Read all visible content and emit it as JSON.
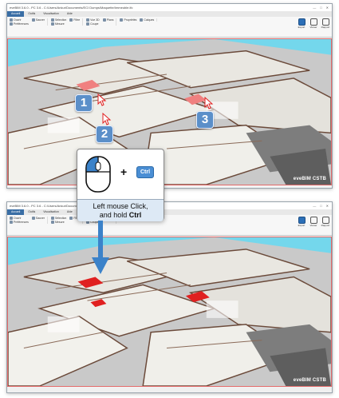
{
  "app": {
    "title": "eveBIM 3.6.0 - PC 3.6 - C:/Users/Ankur/Documents/ECI Dumps/Maquette/Immeuble.ifc",
    "window_controls": [
      "—",
      "□",
      "✕"
    ],
    "tabs": [
      {
        "label": "Accueil",
        "active": true
      },
      {
        "label": "Outils",
        "active": false
      },
      {
        "label": "Visualisation",
        "active": false
      },
      {
        "label": "Aide",
        "active": false
      }
    ],
    "ribbon_groups": [
      {
        "items": [
          {
            "label": "Ouvrir",
            "icon": "folder-icon"
          },
          {
            "label": "Sauver",
            "icon": "save-icon"
          },
          {
            "label": "Préférences",
            "icon": "gear-icon"
          }
        ]
      },
      {
        "items": [
          {
            "label": "Sélection",
            "icon": "select-icon"
          },
          {
            "label": "Filtre",
            "icon": "filter-icon"
          },
          {
            "label": "Mesure",
            "icon": "ruler-icon"
          }
        ]
      },
      {
        "items": [
          {
            "label": "Vue 3D",
            "icon": "cube-icon"
          },
          {
            "label": "Plans",
            "icon": "plan-icon"
          },
          {
            "label": "Coupe",
            "icon": "section-icon"
          }
        ]
      },
      {
        "items": [
          {
            "label": "Propriétés",
            "icon": "list-icon"
          },
          {
            "label": "Calques",
            "icon": "layers-icon"
          }
        ]
      }
    ],
    "big_buttons": [
      {
        "label": "Export",
        "icon": "export-icon",
        "accent": true
      },
      {
        "label": "Viewer",
        "icon": "monitor-icon",
        "accent": false
      },
      {
        "label": "Rapport",
        "icon": "report-icon",
        "accent": false
      }
    ],
    "brand_name": "eveBIM CSTB"
  },
  "instructions": {
    "step_badges": [
      "1",
      "2",
      "3"
    ],
    "plus_sign": "+",
    "key_label": "Ctrl",
    "caption_line1": "Left mouse Click,",
    "caption_line2_prefix": "and hold ",
    "caption_line2_key": "Ctrl"
  },
  "colors": {
    "accent_blue": "#5b8fc9",
    "selection_red": "#e02020",
    "hover_pink": "#f08080",
    "sky": "#74d7ec"
  }
}
